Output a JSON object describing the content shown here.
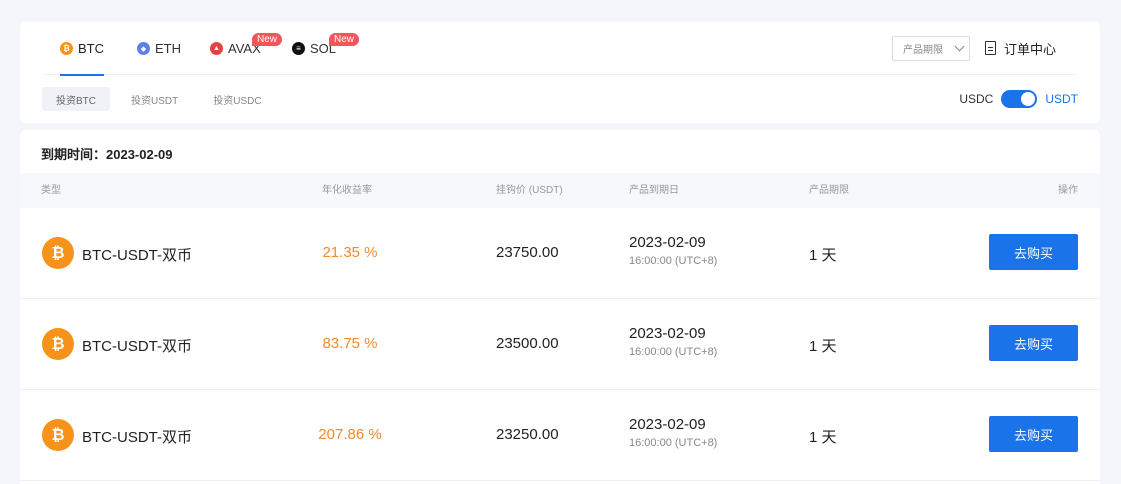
{
  "coins": [
    {
      "label": "BTC",
      "color": "#f7931a",
      "glyph": "₿",
      "badge": ""
    },
    {
      "label": "ETH",
      "color": "#627eea",
      "glyph": "◆",
      "badge": ""
    },
    {
      "label": "AVAX",
      "color": "#e84142",
      "glyph": "▲",
      "badge": "New"
    },
    {
      "label": "SOL",
      "color": "#111111",
      "glyph": "≡",
      "badge": "New"
    }
  ],
  "header": {
    "period_select": "产品期限",
    "order_center": "订单中心"
  },
  "invest_tabs": [
    "投资BTC",
    "投资USDT",
    "投资USDC"
  ],
  "toggle": {
    "left": "USDC",
    "right": "USDT",
    "on": true
  },
  "expiry_title": "到期时间：2023-02-09",
  "table": {
    "headers": [
      "类型",
      "年化收益率",
      "挂钩价 (USDT)",
      "产品到期日",
      "产品期限",
      "操作"
    ],
    "rows": [
      {
        "pair": "BTC-USDT-双币",
        "rate": "21.35 %",
        "price": "23750.00",
        "date": "2023-02-09",
        "time": "16:00:00 (UTC+8)",
        "period": "1 天",
        "action": "去购买"
      },
      {
        "pair": "BTC-USDT-双币",
        "rate": "83.75 %",
        "price": "23500.00",
        "date": "2023-02-09",
        "time": "16:00:00 (UTC+8)",
        "period": "1 天",
        "action": "去购买"
      },
      {
        "pair": "BTC-USDT-双币",
        "rate": "207.86 %",
        "price": "23250.00",
        "date": "2023-02-09",
        "time": "16:00:00 (UTC+8)",
        "period": "1 天",
        "action": "去购买"
      }
    ]
  },
  "colors": {
    "accent": "#1a73e8",
    "rate": "#f08a2e",
    "btc": "#f7931a",
    "badge": "#f0565a"
  }
}
